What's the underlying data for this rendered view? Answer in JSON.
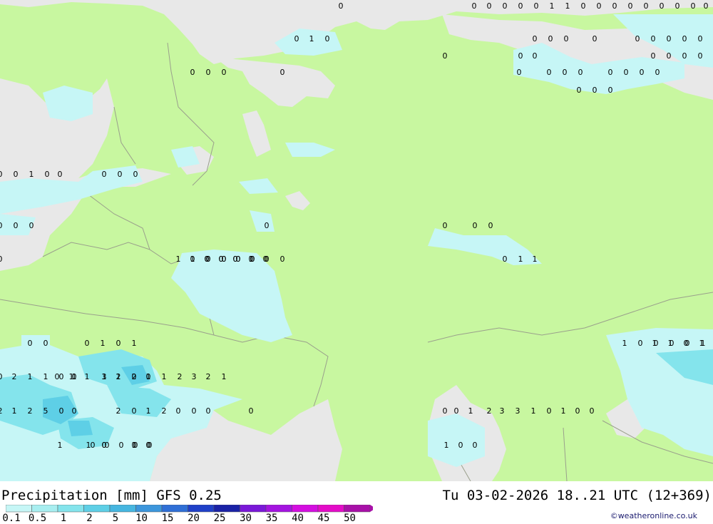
{
  "map": {
    "title": "Precipitation [mm]",
    "model": "GFS 0.25",
    "valid_time": "Tu 03-02-2026 18..21 UTC (12+369)",
    "credit": "©weatheronline.co.uk",
    "colors": {
      "land": "#c8f7a0",
      "sea": "#e8e8e8",
      "border": "#9aa08c",
      "coast": "#8a9080"
    }
  },
  "legend": {
    "labels": [
      "0.1",
      "0.5",
      "1",
      "2",
      "5",
      "10",
      "15",
      "20",
      "25",
      "30",
      "35",
      "40",
      "45",
      "50"
    ],
    "colors": [
      "#c6f6f6",
      "#a8eef0",
      "#84e4ec",
      "#5ecfe6",
      "#46b6e0",
      "#3c96dc",
      "#2f6fd6",
      "#1f40c8",
      "#1a22a6",
      "#7a18d8",
      "#a414e0",
      "#d40ee0",
      "#e40cc8",
      "#a810a8"
    ]
  },
  "precip_values": [
    [
      "0",
      "0",
      "0",
      "0",
      "0",
      "0",
      "1",
      "1",
      "0",
      "0",
      "0",
      "0",
      "0",
      "0",
      "0",
      "0",
      "0",
      "0",
      "0",
      "0"
    ],
    [
      "0",
      "1",
      "0",
      "0",
      "0",
      "0",
      "0",
      "0",
      "0",
      "0",
      "0",
      "0",
      "0"
    ],
    [
      "0",
      "0",
      "0",
      "0",
      "0",
      "0",
      "0",
      "0"
    ],
    [
      "0",
      "0",
      "0",
      "0",
      "0",
      "0",
      "0",
      "0",
      "0",
      "0",
      "0",
      "0"
    ],
    [
      "0",
      "0",
      "0"
    ],
    [
      "0",
      "0",
      "0",
      "0",
      "0",
      "1",
      "0",
      "0"
    ],
    [
      "0",
      "0",
      "0",
      "0",
      "0",
      "0",
      "0"
    ],
    [
      "0",
      "0",
      "0",
      "0",
      "0",
      "0",
      "1",
      "1",
      "1",
      "1",
      "0",
      "0",
      "0",
      "1",
      "0",
      "0",
      "0",
      "0",
      "0",
      "0",
      "0",
      "0",
      "0",
      "0",
      "0",
      "0",
      "0"
    ],
    [
      "0",
      "0",
      "0",
      "1",
      "0",
      "1",
      "1",
      "1",
      "0",
      "1",
      "1",
      "0",
      "0",
      "0",
      "0",
      "1",
      "1"
    ],
    [
      "0",
      "2",
      "1",
      "1",
      "0",
      "1",
      "3",
      "2",
      "2",
      "1",
      "0",
      "1",
      "1",
      "0",
      "0",
      "1",
      "2",
      "3",
      "2",
      "1",
      "1",
      "1",
      "0"
    ],
    [
      "2",
      "1",
      "2",
      "5",
      "0",
      "0",
      "2",
      "0",
      "1",
      "2",
      "0",
      "0",
      "0",
      "0",
      "0",
      "0",
      "1",
      "2",
      "3",
      "3",
      "1",
      "0",
      "1",
      "0",
      "0"
    ],
    [
      "1",
      "1",
      "0",
      "1",
      "0",
      "1",
      "0",
      "0",
      "0",
      "0",
      "0",
      "0",
      "0",
      "0",
      "0",
      "0"
    ]
  ]
}
